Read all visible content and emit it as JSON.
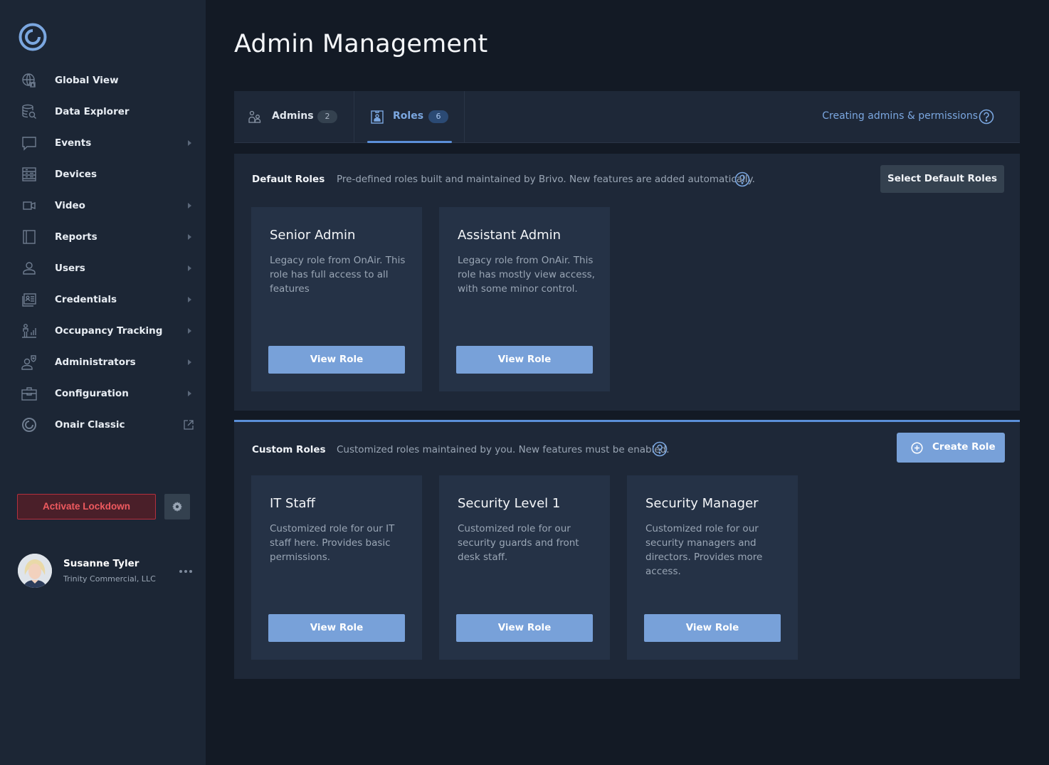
{
  "sidebar": {
    "items": [
      {
        "label": "Global View",
        "icon": "globe-icon",
        "has_arrow": false
      },
      {
        "label": "Data Explorer",
        "icon": "data-explorer-icon",
        "has_arrow": false
      },
      {
        "label": "Events",
        "icon": "chat-bubble-icon",
        "has_arrow": true
      },
      {
        "label": "Devices",
        "icon": "devices-icon",
        "has_arrow": false
      },
      {
        "label": "Video",
        "icon": "video-camera-icon",
        "has_arrow": true
      },
      {
        "label": "Reports",
        "icon": "reports-icon",
        "has_arrow": true
      },
      {
        "label": "Users",
        "icon": "user-icon",
        "has_arrow": true
      },
      {
        "label": "Credentials",
        "icon": "credentials-icon",
        "has_arrow": true
      },
      {
        "label": "Occupancy Tracking",
        "icon": "occupancy-icon",
        "has_arrow": true
      },
      {
        "label": "Administrators",
        "icon": "administrators-icon",
        "has_arrow": true
      },
      {
        "label": "Configuration",
        "icon": "briefcase-icon",
        "has_arrow": true
      },
      {
        "label": "Onair Classic",
        "icon": "onair-logo-icon",
        "has_arrow": false,
        "external": true
      }
    ],
    "lockdown_label": "Activate Lockdown",
    "user": {
      "name": "Susanne Tyler",
      "org": "Trinity Commercial, LLC"
    }
  },
  "page": {
    "title": "Admin Management"
  },
  "tabs": {
    "admins": {
      "label": "Admins",
      "count": "2"
    },
    "roles": {
      "label": "Roles",
      "count": "6"
    },
    "help_link": "Creating admins & permissions",
    "active": "roles"
  },
  "default_roles": {
    "title": "Default Roles",
    "description": "Pre-defined roles built and maintained by Brivo. New features are added automatically.",
    "select_button": "Select Default Roles",
    "cards": [
      {
        "title": "Senior Admin",
        "description": "Legacy role from OnAir. This role has full access to all features",
        "button": "View Role"
      },
      {
        "title": "Assistant Admin",
        "description": "Legacy role from OnAir. This role has mostly view access, with some minor control.",
        "button": "View Role"
      }
    ]
  },
  "custom_roles": {
    "title": "Custom Roles",
    "description": "Customized roles maintained by you. New features must be enabled.",
    "create_button": "Create Role",
    "cards": [
      {
        "title": "IT Staff",
        "description": "Customized role for our IT staff here. Provides basic permissions.",
        "button": "View Role"
      },
      {
        "title": "Security Level 1",
        "description": "Customized role for our security guards and front desk staff.",
        "button": "View Role"
      },
      {
        "title": "Security Manager",
        "description": "Customized role for our security managers and directors. Provides more access.",
        "button": "View Role"
      }
    ]
  },
  "colors": {
    "accent": "#5b8fd8",
    "button": "#78a1d9",
    "danger": "#ef5a5f",
    "sidebar_bg": "#1c2635",
    "page_bg": "#131a25",
    "panel_bg": "#1e2838"
  }
}
